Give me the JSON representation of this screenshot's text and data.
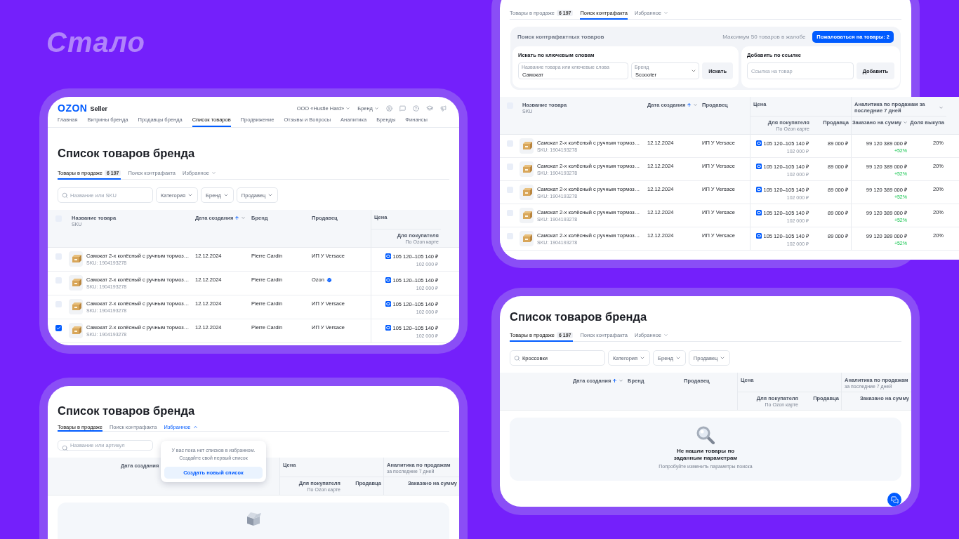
{
  "slide_title": "Стало",
  "main_screen": {
    "logo": {
      "name": "OZON",
      "suffix": "Seller"
    },
    "account": "ООО «Hustle Hard»",
    "role": "Бренд",
    "nav": [
      {
        "label": "Главная",
        "selected": false
      },
      {
        "label": "Витрины бренда",
        "selected": false
      },
      {
        "label": "Продавцы бренда",
        "selected": false
      },
      {
        "label": "Список товаров",
        "selected": true
      },
      {
        "label": "Продвижение",
        "selected": false
      },
      {
        "label": "Отзывы и Вопросы",
        "selected": false
      },
      {
        "label": "Аналитика",
        "selected": false
      },
      {
        "label": "Бренды",
        "selected": false
      },
      {
        "label": "Финансы",
        "selected": false
      }
    ],
    "title": "Список товаров бренда",
    "tabs": [
      {
        "label": "Товары в продаже",
        "count": "6 197",
        "selected": true,
        "kind": "plain"
      },
      {
        "label": "Поиск контрафакта",
        "selected": false,
        "kind": "plain"
      },
      {
        "label": "Избранное",
        "selected": false,
        "kind": "menu",
        "expanded": false
      }
    ],
    "search": {
      "placeholder": "Название или SKU"
    },
    "filters": [
      "Категория",
      "Бренд",
      "Продавец"
    ],
    "table": {
      "all_checked": false,
      "columns": [
        {
          "label": "Название товара",
          "sublabel": "SKU"
        },
        {
          "label": "Дата создания",
          "sorted": true,
          "dropdown": true
        },
        {
          "label": "Бренд"
        },
        {
          "label": "Продавец"
        }
      ],
      "groups": [
        {
          "label": "Цена",
          "columns": [
            {
              "label": "Для покупателя",
              "sublabel": "По Ozon карте"
            }
          ]
        }
      ],
      "rows": [
        {
          "checked": false,
          "name": "Самокат 2-х колёсный с ручным тормоз…",
          "sku": "SKU: 1904193278",
          "date": "12.12.2024",
          "brand": "Pierre Cardin",
          "seller": "ИП У Versace",
          "seller_verified": false,
          "price": "105 120–105 140 ₽",
          "old_price": "102 000 ₽"
        },
        {
          "checked": false,
          "name": "Самокат 2-х колёсный с ручным тормоз…",
          "sku": "SKU: 1904193278",
          "date": "12.12.2024",
          "brand": "Pierre Cardin",
          "seller": "Ozon",
          "seller_verified": true,
          "price": "105 120–105 140 ₽",
          "old_price": "102 000 ₽"
        },
        {
          "checked": false,
          "name": "Самокат 2-х колёсный с ручным тормоз…",
          "sku": "SKU: 1904193278",
          "date": "12.12.2024",
          "brand": "Pierre Cardin",
          "seller": "ИП У Versace",
          "seller_verified": false,
          "price": "105 120–105 140 ₽",
          "old_price": "102 000 ₽"
        },
        {
          "checked": true,
          "name": "Самокат 2-х колёсный с ручным тормоз…",
          "sku": "SKU: 1904193278",
          "date": "12.12.2024",
          "brand": "Pierre Cardin",
          "seller": "ИП У Versace",
          "seller_verified": false,
          "price": "105 120–105 140 ₽",
          "old_price": "102 000 ₽"
        }
      ]
    }
  },
  "counterfeit_screen": {
    "tabs": [
      {
        "label": "Товары в продаже",
        "count": "6 197",
        "selected": false,
        "kind": "plain"
      },
      {
        "label": "Поиск контрафакта",
        "selected": true,
        "kind": "plain"
      },
      {
        "label": "Избранное",
        "selected": false,
        "kind": "menu",
        "expanded": false
      }
    ],
    "counterfeit": {
      "title": "Поиск контрафактных товаров",
      "limit_note": "Максимум 50 товаров в жалобе",
      "report_button": "Пожаловаться на товары: 2",
      "keyword_search": {
        "heading": "Искать по ключевым словам",
        "query": {
          "label": "Название товара или ключевые слова",
          "value": "Самокат"
        },
        "brand": {
          "label": "Бренд",
          "value": "Scoooter"
        },
        "button": "Искать"
      },
      "link_add": {
        "heading": "Добавить по ссылке",
        "link": {
          "placeholder": "Ссылка на товар"
        },
        "button": "Добавить"
      }
    },
    "table": {
      "all_checked": false,
      "columns": [
        {
          "label": "Название товара",
          "sublabel": "SKU"
        },
        {
          "label": "Дата создания",
          "sorted": true,
          "dropdown": true
        },
        {
          "label": "Продавец"
        }
      ],
      "groups": [
        {
          "label": "Цена",
          "columns": [
            {
              "label": "Для покупателя",
              "sublabel": "По Ozon карте"
            },
            {
              "label": "Продавца"
            }
          ]
        },
        {
          "label": "Аналитика по продажам за последние 7 дней",
          "dropdown": true,
          "columns": [
            {
              "label": "Заказано на сумму",
              "dropdown": true
            },
            {
              "label": "Доля выкупа"
            }
          ]
        }
      ],
      "rows": [
        {
          "checked": false,
          "name": "Самокат 2-х колёсный с ручным тормоз…",
          "sku": "SKU: 1904193278",
          "date": "12.12.2024",
          "seller": "ИП У Versace",
          "seller_verified": false,
          "price": "105 120–105 140 ₽",
          "old_price": "102 000 ₽",
          "seller_price": "89 000 ₽",
          "ordered": "99 120 389 000 ₽",
          "growth": "+52%",
          "buyout": "20%"
        },
        {
          "checked": false,
          "name": "Самокат 2-х колёсный с ручным тормоз…",
          "sku": "SKU: 1904193278",
          "date": "12.12.2024",
          "seller": "ИП У Versace",
          "seller_verified": false,
          "price": "105 120–105 140 ₽",
          "old_price": "102 000 ₽",
          "seller_price": "89 000 ₽",
          "ordered": "99 120 389 000 ₽",
          "growth": "+52%",
          "buyout": "20%"
        },
        {
          "checked": false,
          "name": "Самокат 2-х колёсный с ручным тормоз…",
          "sku": "SKU: 1904193278",
          "date": "12.12.2024",
          "seller": "ИП У Versace",
          "seller_verified": false,
          "price": "105 120–105 140 ₽",
          "old_price": "102 000 ₽",
          "seller_price": "89 000 ₽",
          "ordered": "99 120 389 000 ₽",
          "growth": "+52%",
          "buyout": "20%"
        },
        {
          "checked": false,
          "name": "Самокат 2-х колёсный с ручным тормоз…",
          "sku": "SKU: 1904193278",
          "date": "12.12.2024",
          "seller": "ИП У Versace",
          "seller_verified": false,
          "price": "105 120–105 140 ₽",
          "old_price": "102 000 ₽",
          "seller_price": "89 000 ₽",
          "ordered": "99 120 389 000 ₽",
          "growth": "+52%",
          "buyout": "20%"
        },
        {
          "checked": false,
          "name": "Самокат 2-х колёсный с ручным тормоз…",
          "sku": "SKU: 1904193278",
          "date": "12.12.2024",
          "seller": "ИП У Versace",
          "seller_verified": false,
          "price": "105 120–105 140 ₽",
          "old_price": "102 000 ₽",
          "seller_price": "89 000 ₽",
          "ordered": "99 120 389 000 ₽",
          "growth": "+52%",
          "buyout": "20%"
        }
      ]
    }
  },
  "favorites_screen": {
    "title": "Список товаров бренда",
    "tabs": [
      {
        "label": "Товары в продаже",
        "selected": true,
        "kind": "plain"
      },
      {
        "label": "Поиск контрафакта",
        "selected": false,
        "kind": "plain"
      },
      {
        "label": "Избранное",
        "selected": false,
        "kind": "menu",
        "expanded": true
      }
    ],
    "search": {
      "placeholder": "Название или артикул"
    },
    "favorites_popup": {
      "message": "У вас пока нет списков в избранном. Создайте свой первый список",
      "button": "Создать новый список"
    },
    "table": {
      "columns": [
        {
          "label": "Дата создания"
        }
      ],
      "groups": [
        {
          "label": "Цена",
          "columns": [
            {
              "label": "Для покупателя",
              "sublabel": "По Ozon карте"
            },
            {
              "label": "Продавца"
            }
          ]
        },
        {
          "label": "Аналитика по продажам",
          "sublabel": "за последние 7 дней",
          "columns": [
            {
              "label": "Заказано на сумму"
            }
          ]
        }
      ]
    },
    "empty_state": {
      "kind": "box"
    }
  },
  "empty_search_screen": {
    "title": "Список товаров бренда",
    "tabs": [
      {
        "label": "Товары в продаже",
        "count": "6 197",
        "selected": true,
        "kind": "plain"
      },
      {
        "label": "Поиск контрафакта",
        "selected": false,
        "kind": "plain"
      },
      {
        "label": "Избранное",
        "selected": false,
        "kind": "menu",
        "expanded": false
      }
    ],
    "search": {
      "value": "Кроссовки"
    },
    "filters": [
      "Категория",
      "Бренд",
      "Продавец"
    ],
    "table": {
      "columns": [
        {
          "label": "Дата создания",
          "sorted": true,
          "dropdown": true
        },
        {
          "label": "Бренд"
        },
        {
          "label": "Продавец"
        }
      ],
      "groups": [
        {
          "label": "Цена",
          "columns": [
            {
              "label": "Для покупателя",
              "sublabel": "По Ozon карте"
            },
            {
              "label": "Продавца"
            }
          ]
        },
        {
          "label": "Аналитика по продажам",
          "sublabel": "за последние 7 дней",
          "columns": [
            {
              "label": "Заказано на сумму"
            }
          ]
        }
      ]
    },
    "empty_state": {
      "kind": "search",
      "title": "Не нашли товары по заданным параметрам",
      "hint": "Попробуйте изменить параметры поиска"
    }
  }
}
